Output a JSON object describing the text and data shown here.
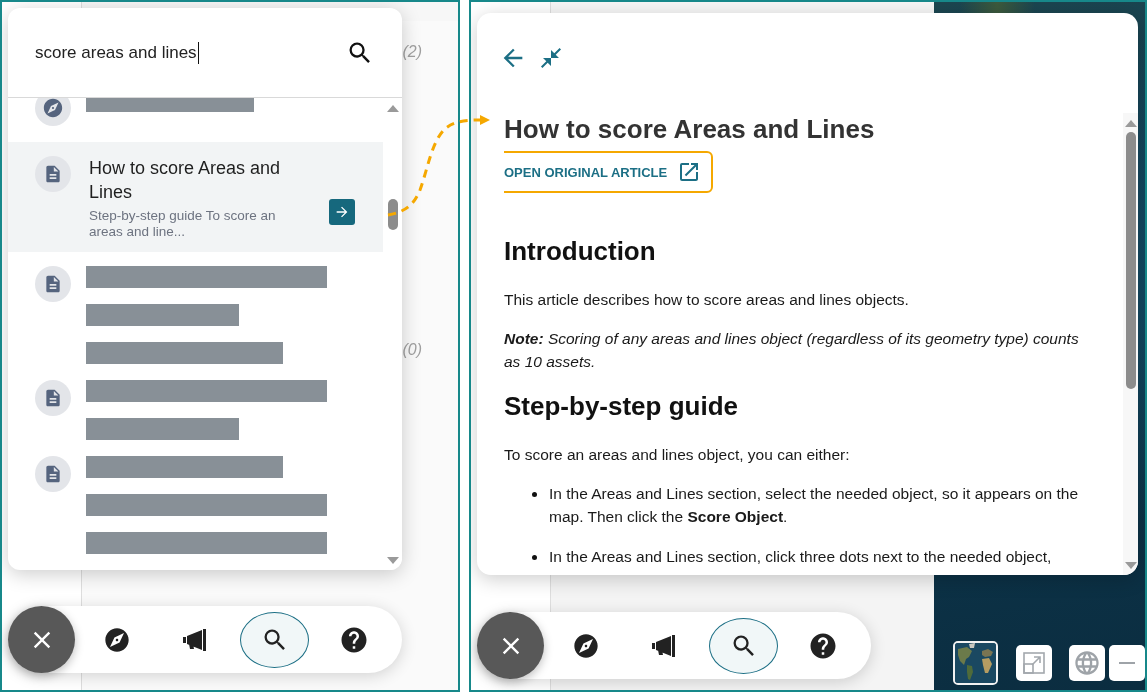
{
  "left_screen": {
    "background_counts": [
      "(2)",
      "(0)"
    ],
    "search_panel": {
      "query": "score areas and lines",
      "results": [
        {
          "kind": "navigation",
          "selected": false,
          "redacted_lines": [
            {
              "kind": "mid"
            }
          ]
        },
        {
          "kind": "article",
          "selected": true,
          "title": "How to score Areas and Lines",
          "summary": "Step-by-step guide To score an areas and line..."
        },
        {
          "kind": "article",
          "selected": false,
          "redacted_lines": [
            {
              "kind": "full"
            },
            {
              "kind": "short"
            },
            {
              "kind": "wide"
            }
          ]
        },
        {
          "kind": "article",
          "selected": false,
          "redacted_lines": [
            {
              "kind": "full"
            },
            {
              "kind": "short"
            }
          ]
        },
        {
          "kind": "article",
          "selected": false,
          "redacted_lines": [
            {
              "kind": "wide"
            },
            {
              "kind": "full"
            },
            {
              "kind": "full"
            }
          ]
        }
      ]
    },
    "toolbar": [
      {
        "kind": "close"
      },
      {
        "kind": "explore",
        "selected": false
      },
      {
        "kind": "announcements",
        "selected": false
      },
      {
        "kind": "search",
        "selected": true
      },
      {
        "kind": "help",
        "selected": false
      }
    ]
  },
  "annotation_arrow": true,
  "right_screen": {
    "article_panel": {
      "title": "How to score Areas and Lines",
      "open_original_button": {
        "label": "OPEN ORIGINAL ARTICLE",
        "highlighted": true
      },
      "body": [
        {
          "kind": "heading",
          "text": "Introduction"
        },
        {
          "kind": "paragraph",
          "text": "This article describes how to score areas and lines objects."
        },
        {
          "kind": "note",
          "text": "**Note:** Scoring of any areas and lines object (regardless of its geometry type) counts as 10 assets."
        },
        {
          "kind": "heading",
          "text": "Step-by-step guide"
        },
        {
          "kind": "paragraph",
          "text": "To score an areas and lines object, you can either:"
        },
        {
          "kind": "list",
          "items": [
            "In the Areas and Lines section, select the needed object, so it appears on the map. Then click the **Score Object**.",
            "In the Areas and Lines section, click three dots next to the needed object,"
          ]
        }
      ]
    },
    "toolbar": [
      {
        "kind": "close"
      },
      {
        "kind": "explore",
        "selected": false
      },
      {
        "kind": "announcements",
        "selected": false
      },
      {
        "kind": "search",
        "selected": true
      },
      {
        "kind": "help",
        "selected": false
      }
    ],
    "map_controls": [
      {
        "kind": "basemap"
      },
      {
        "kind": "fullscreen"
      },
      {
        "kind": "globe"
      },
      {
        "kind": "zoom_out"
      }
    ]
  }
}
